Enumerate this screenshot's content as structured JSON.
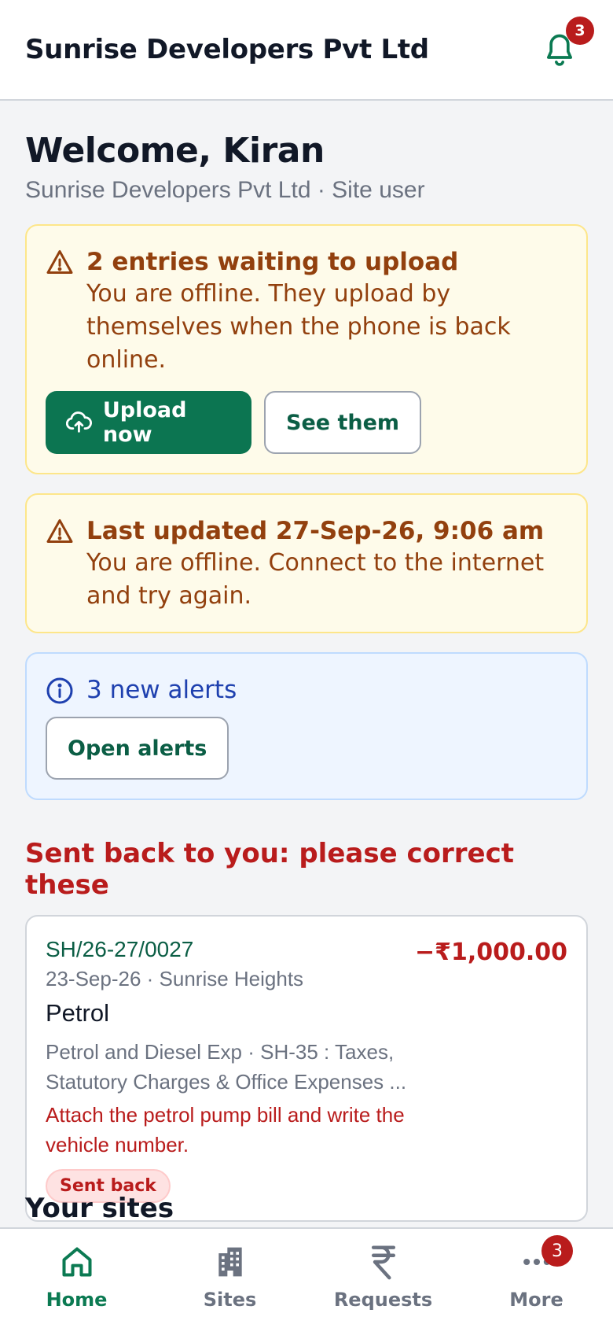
{
  "header": {
    "title": "Sunrise Developers Pvt Ltd",
    "notification_count": "3"
  },
  "welcome": {
    "greeting": "Welcome, Kiran",
    "subtitle": "Sunrise Developers Pvt Ltd · Site user"
  },
  "upload_banner": {
    "title": "2 entries waiting to upload",
    "text": "You are offline. They upload by themselves when the phone is back online.",
    "primary_label": "Upload now",
    "secondary_label": "See them"
  },
  "offline_banner": {
    "title": "Last updated 27-Sep-26, 9:06 am",
    "text": "You are offline. Connect to the internet and try again."
  },
  "alerts_banner": {
    "title": "3 new alerts",
    "button_label": "Open alerts"
  },
  "sent_back": {
    "heading": "Sent back to you: please correct these",
    "entries": [
      {
        "ref": "SH/26-27/0027",
        "amount": "−₹1,000.00",
        "meta": "23-Sep-26 · Sunrise Heights",
        "name": "Petrol",
        "desc": "Petrol and Diesel Exp · SH-35 : Taxes, Statutory Charges & Office Expenses ...",
        "note": "Attach the petrol pump bill and write the vehicle number.",
        "status": "Sent back"
      }
    ]
  },
  "sites": {
    "heading": "Your sites"
  },
  "nav": {
    "items": [
      {
        "label": "Home",
        "icon": "home-icon"
      },
      {
        "label": "Sites",
        "icon": "building-icon"
      },
      {
        "label": "Requests",
        "icon": "rupee-icon"
      },
      {
        "label": "More",
        "icon": "more-icon",
        "badge": "3"
      }
    ]
  },
  "colors": {
    "brand_green": "#0c7551",
    "alert_red": "#b91c1c",
    "warning_brown": "#92400e",
    "info_blue": "#1e40af"
  }
}
